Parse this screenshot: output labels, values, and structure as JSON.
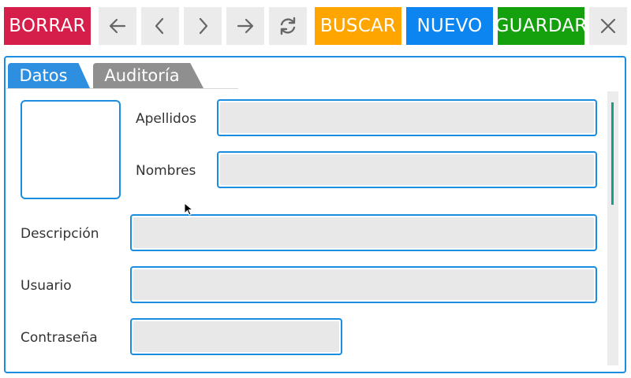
{
  "toolbar": {
    "borrar": "BORRAR",
    "buscar": "BUSCAR",
    "nuevo": "NUEVO",
    "guardar": "GUARDAR",
    "nav_icons": [
      "arrow-left-icon",
      "chevron-left-icon",
      "chevron-right-icon",
      "arrow-right-icon",
      "refresh-icon",
      "close-icon"
    ]
  },
  "tabs": [
    {
      "label": "Datos",
      "active": true
    },
    {
      "label": "Auditoría",
      "active": false
    }
  ],
  "form": {
    "apellidos": {
      "label": "Apellidos",
      "value": ""
    },
    "nombres": {
      "label": "Nombres",
      "value": ""
    },
    "descripcion": {
      "label": "Descripción",
      "value": ""
    },
    "usuario": {
      "label": "Usuario",
      "value": ""
    },
    "contrasena": {
      "label": "Contraseña",
      "value": ""
    }
  },
  "colors": {
    "borrar": "#d51e4a",
    "buscar": "#ffa500",
    "nuevo": "#0d85f0",
    "guardar": "#15a00d",
    "accent": "#1a8de0"
  }
}
